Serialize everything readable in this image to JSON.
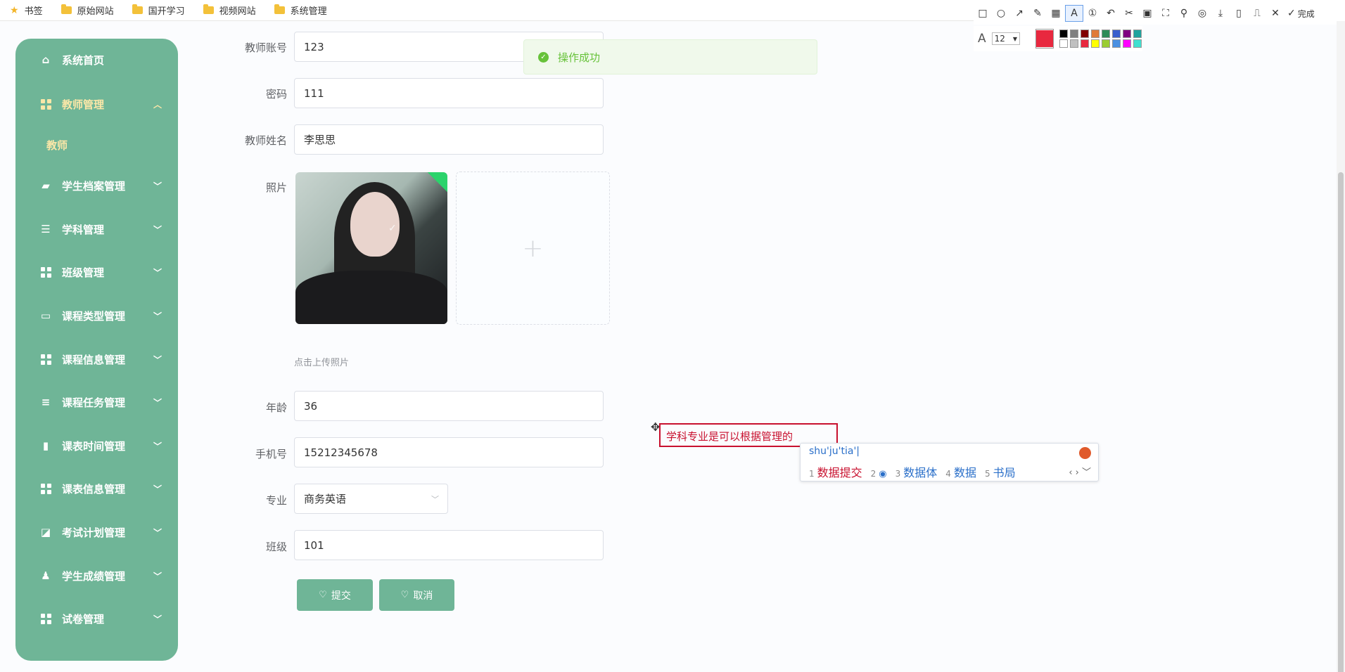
{
  "bookmarks": [
    {
      "label": "书签",
      "icon": "star-icon"
    },
    {
      "label": "原始网站",
      "icon": "folder-icon"
    },
    {
      "label": "国开学习",
      "icon": "folder-icon"
    },
    {
      "label": "视频网站",
      "icon": "folder-icon"
    },
    {
      "label": "系统管理",
      "icon": "folder-icon"
    }
  ],
  "sidebar": {
    "accent": "#6fb597",
    "active_color": "#fbe7a8",
    "items": [
      {
        "label": "系统首页",
        "icon": "home-icon"
      },
      {
        "label": "教师管理",
        "icon": "grid-icon",
        "expanded": true
      },
      {
        "label": "学生档案管理",
        "icon": "briefcase-icon"
      },
      {
        "label": "学科管理",
        "icon": "sliders-icon"
      },
      {
        "label": "班级管理",
        "icon": "grid-icon"
      },
      {
        "label": "课程类型管理",
        "icon": "chat-icon"
      },
      {
        "label": "课程信息管理",
        "icon": "grid-icon"
      },
      {
        "label": "课程任务管理",
        "icon": "list-icon"
      },
      {
        "label": "课表时间管理",
        "icon": "bar-chart-icon"
      },
      {
        "label": "课表信息管理",
        "icon": "grid-icon"
      },
      {
        "label": "考试计划管理",
        "icon": "line-chart-icon"
      },
      {
        "label": "学生成绩管理",
        "icon": "user-icon"
      },
      {
        "label": "试卷管理",
        "icon": "grid-icon"
      }
    ],
    "sub_item": "教师"
  },
  "form": {
    "account_label": "教师账号",
    "account_value": "123",
    "password_label": "密码",
    "password_value": "111",
    "name_label": "教师姓名",
    "name_value": "李思思",
    "photo_label": "照片",
    "photo_hint": "点击上传照片",
    "age_label": "年龄",
    "age_value": "36",
    "phone_label": "手机号",
    "phone_value": "15212345678",
    "major_label": "专业",
    "major_value": "商务英语",
    "class_label": "班级",
    "class_value": "101",
    "submit_label": "提交",
    "cancel_label": "取消"
  },
  "toast": {
    "message": "操作成功",
    "color": "#67c23a"
  },
  "annotation": {
    "text": "学科专业是可以根据管理的",
    "color": "#c8102e"
  },
  "ime": {
    "composition": "shu'ju'tia'|",
    "candidates": [
      {
        "num": "1",
        "text": "数据提交"
      },
      {
        "num": "2",
        "text": ""
      },
      {
        "num": "3",
        "text": "数据体"
      },
      {
        "num": "4",
        "text": "数据"
      },
      {
        "num": "5",
        "text": "书局"
      }
    ]
  },
  "toolbar": {
    "done_label": "完成",
    "font_size": "12",
    "current_color": "#e8283f",
    "palette": [
      "#000000",
      "#808080",
      "#800000",
      "#e07b39",
      "#2e8b57",
      "#3a5fcd",
      "#800080",
      "#20a39e",
      "#ffffff",
      "#c0c0c0",
      "#e8283f",
      "#ffff00",
      "#9acd32",
      "#4a90e2",
      "#ff00ff",
      "#40e0d0"
    ]
  }
}
